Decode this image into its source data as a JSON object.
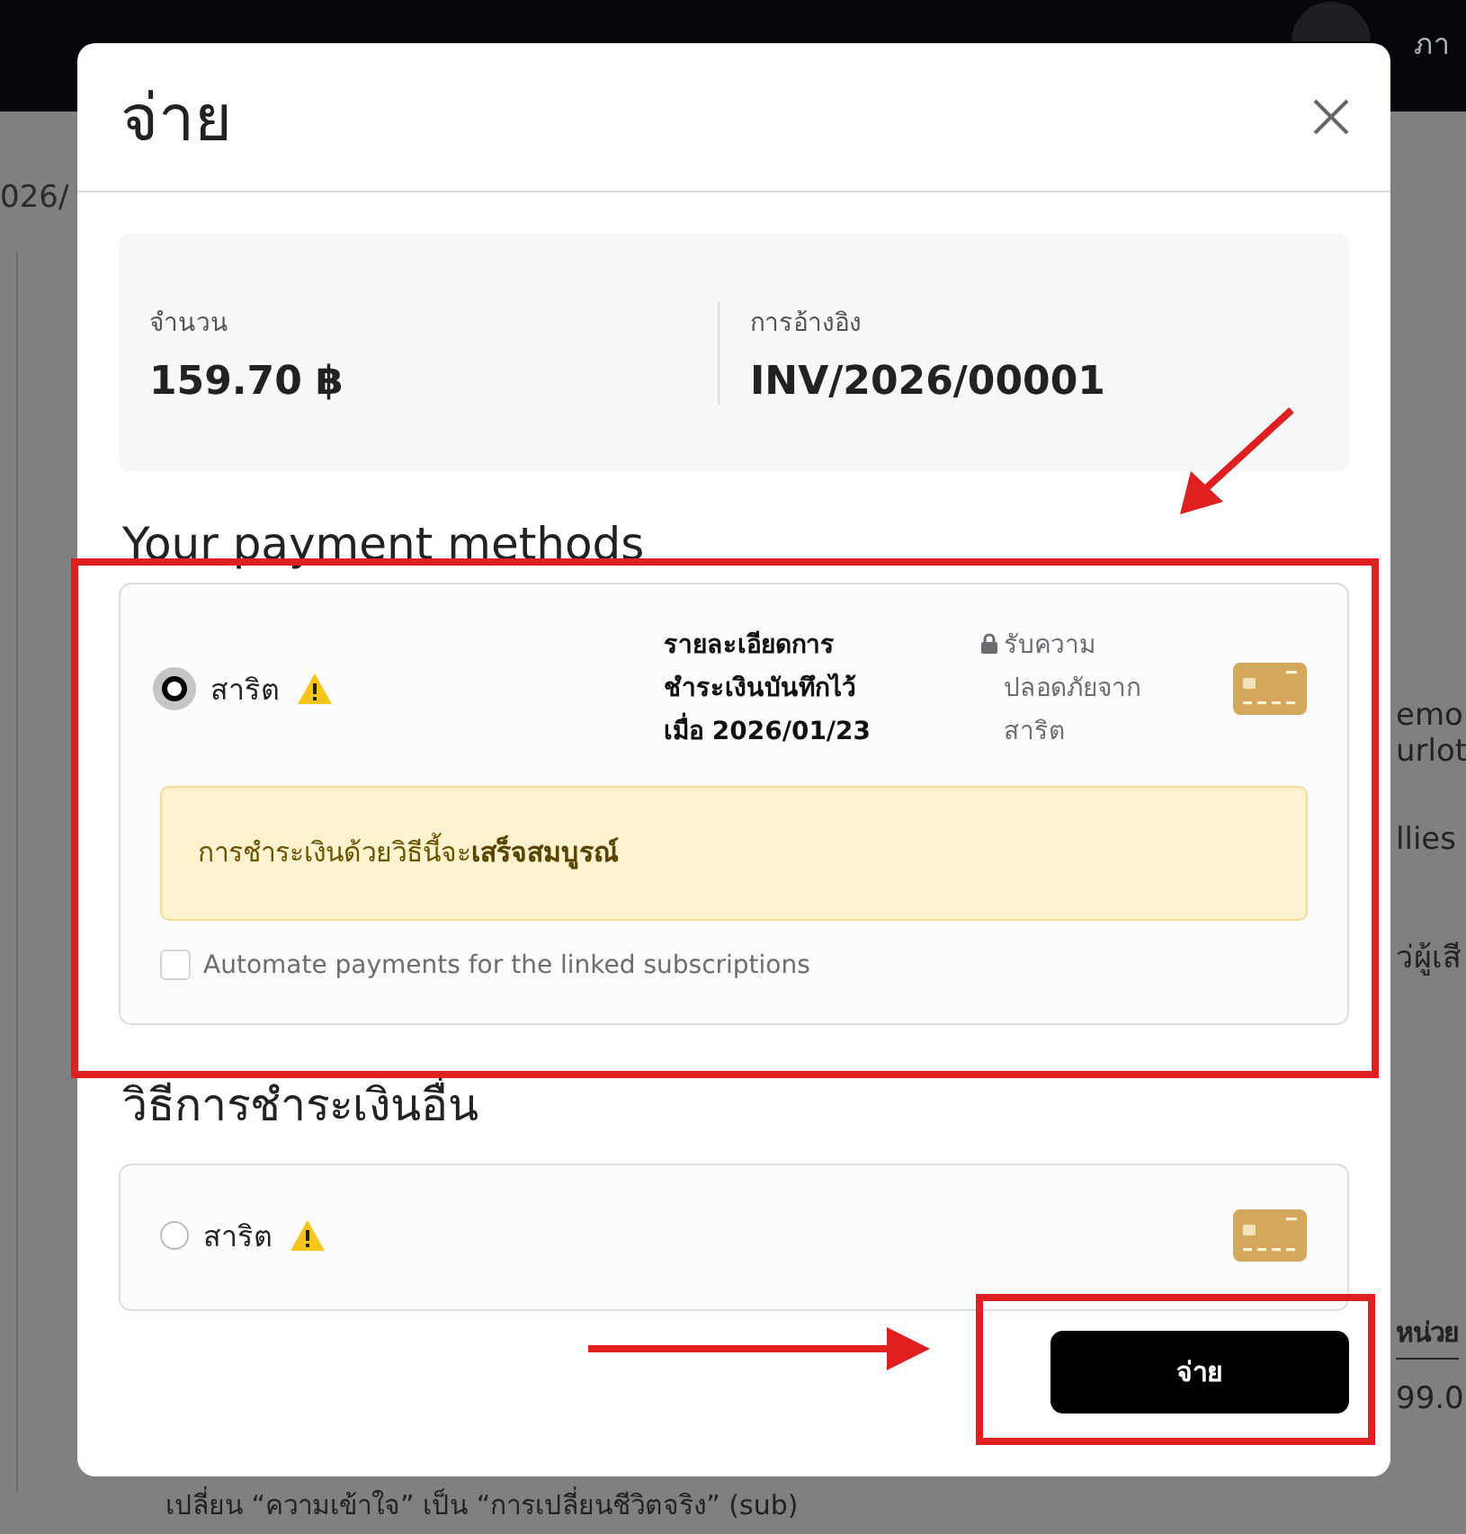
{
  "nav": {
    "language": "ภา"
  },
  "background": {
    "left_fragment": "026/",
    "right_fragments": [
      "emo",
      "urlot",
      "llies",
      "ว่ผู้เสี"
    ],
    "table_heading": "หน่วย",
    "table_value": "99.0",
    "footer_line": "เปลี่ยน “ความเข้าใจ” เป็น “การเปลี่ยนชีวิตจริง” (sub)"
  },
  "dialog": {
    "title": "จ่าย",
    "summary": [
      {
        "label": "จำนวน",
        "value": "159.70 ฿"
      },
      {
        "label": "การอ้างอิง",
        "value": "INV/2026/00001"
      }
    ],
    "saved_heading": "Your payment methods",
    "saved_methods": [
      {
        "name": "สาริต",
        "selected": true,
        "warning": true,
        "details": "รายละเอียดการ\nชำระเงินบันทึกไว้\nเมื่อ 2026/01/23",
        "security": "รับความ\nปลอดภัยจาก\nสาริต",
        "notice": "การชำระเงินด้วยวิธีนี้จะ**เสร็จสมบูรณ์**",
        "automate": {
          "label": "Automate payments for the linked subscriptions",
          "checked": false
        }
      }
    ],
    "other_heading": "วิธีการชำระเงินอื่น",
    "other_methods": [
      {
        "name": "สาริต",
        "selected": false,
        "warning": true
      }
    ],
    "pay_button": "จ่าย"
  }
}
